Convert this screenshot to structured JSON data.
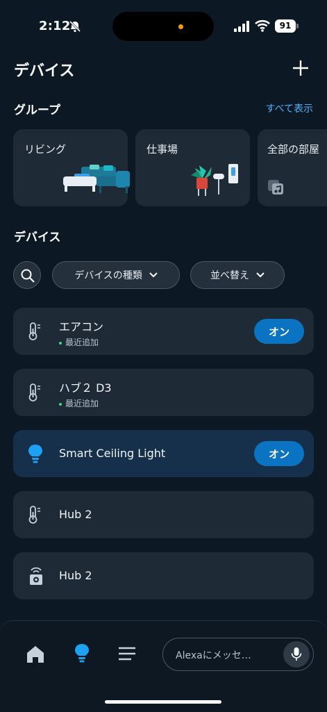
{
  "status_bar": {
    "time": "2:12",
    "battery": "91"
  },
  "header": {
    "title": "デバイス"
  },
  "groups": {
    "title": "グループ",
    "see_all": "すべて表示",
    "items": [
      {
        "label": "リビング"
      },
      {
        "label": "仕事場"
      },
      {
        "label": "全部の部屋"
      }
    ]
  },
  "devices": {
    "title": "デバイス",
    "filters": {
      "type_label": "デバイスの種類",
      "sort_label": "並べ替え"
    },
    "items": [
      {
        "name": "エアコン",
        "sub": "最近追加",
        "action": "オン",
        "icon": "thermometer-icon"
      },
      {
        "name": "ハブ２ D3",
        "sub": "最近追加",
        "icon": "thermometer-icon"
      },
      {
        "name": "Smart Ceiling Light",
        "action": "オン",
        "icon": "lightbulb-icon"
      },
      {
        "name": "Hub 2",
        "icon": "thermometer-icon"
      },
      {
        "name": "Hub 2",
        "icon": "hub-icon"
      }
    ]
  },
  "tabbar": {
    "alexa_placeholder": "Alexaにメッセ…"
  },
  "colors": {
    "accent": "#0a73c2",
    "link": "#4fb3ff",
    "background": "#0c1824",
    "card": "#1e2a35",
    "new_dot": "#3ddc84"
  }
}
